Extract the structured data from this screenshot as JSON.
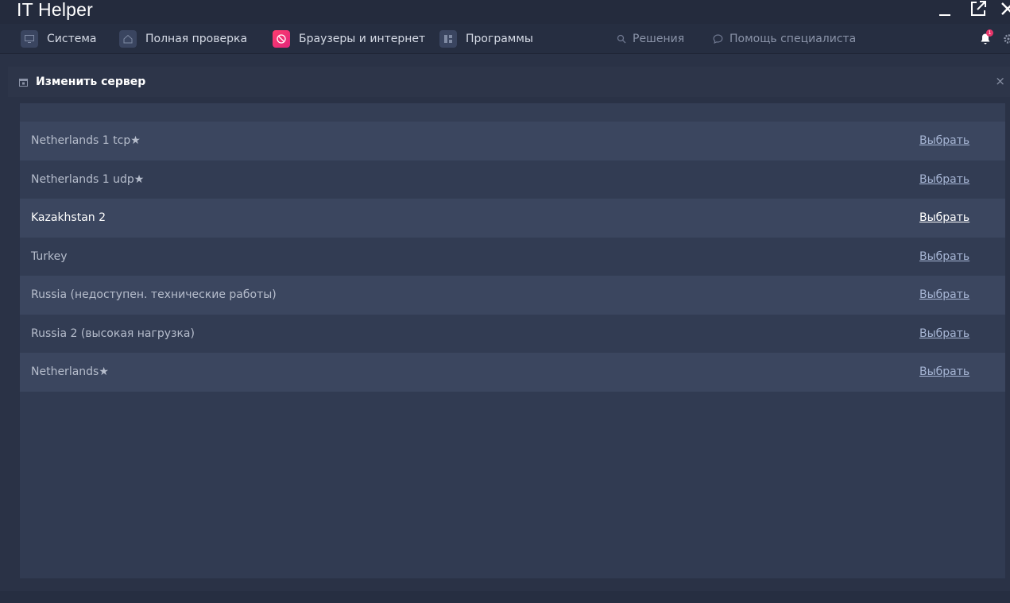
{
  "app": {
    "title": "IT Helper"
  },
  "nav": {
    "items": [
      {
        "label": "Система",
        "icon": "monitor-icon"
      },
      {
        "label": "Полная проверка",
        "icon": "home-icon"
      },
      {
        "label": "Браузеры и интернет",
        "icon": "globe-icon",
        "active": true
      },
      {
        "label": "Программы",
        "icon": "apps-icon"
      }
    ],
    "solutions_label": "Решения",
    "help_label": "Помощь специалиста",
    "notification_count": "1"
  },
  "dialog": {
    "title": "Изменить сервер",
    "close_glyph": "×"
  },
  "servers": [
    {
      "name": "Netherlands 1 tcp★",
      "action": "Выбрать"
    },
    {
      "name": "Netherlands 1 udp★",
      "action": "Выбрать"
    },
    {
      "name": "Kazakhstan 2",
      "action": "Выбрать"
    },
    {
      "name": "Turkey",
      "action": "Выбрать"
    },
    {
      "name": "Russia (недоступен. технические работы)",
      "action": "Выбрать"
    },
    {
      "name": "Russia 2 (высокая нагрузка)",
      "action": "Выбрать"
    },
    {
      "name": "Netherlands★",
      "action": "Выбрать"
    }
  ],
  "colors": {
    "accent": "#e8356a",
    "background": "#2a3246",
    "row_alt": "#3b465f",
    "link": "#a6b5d4"
  }
}
